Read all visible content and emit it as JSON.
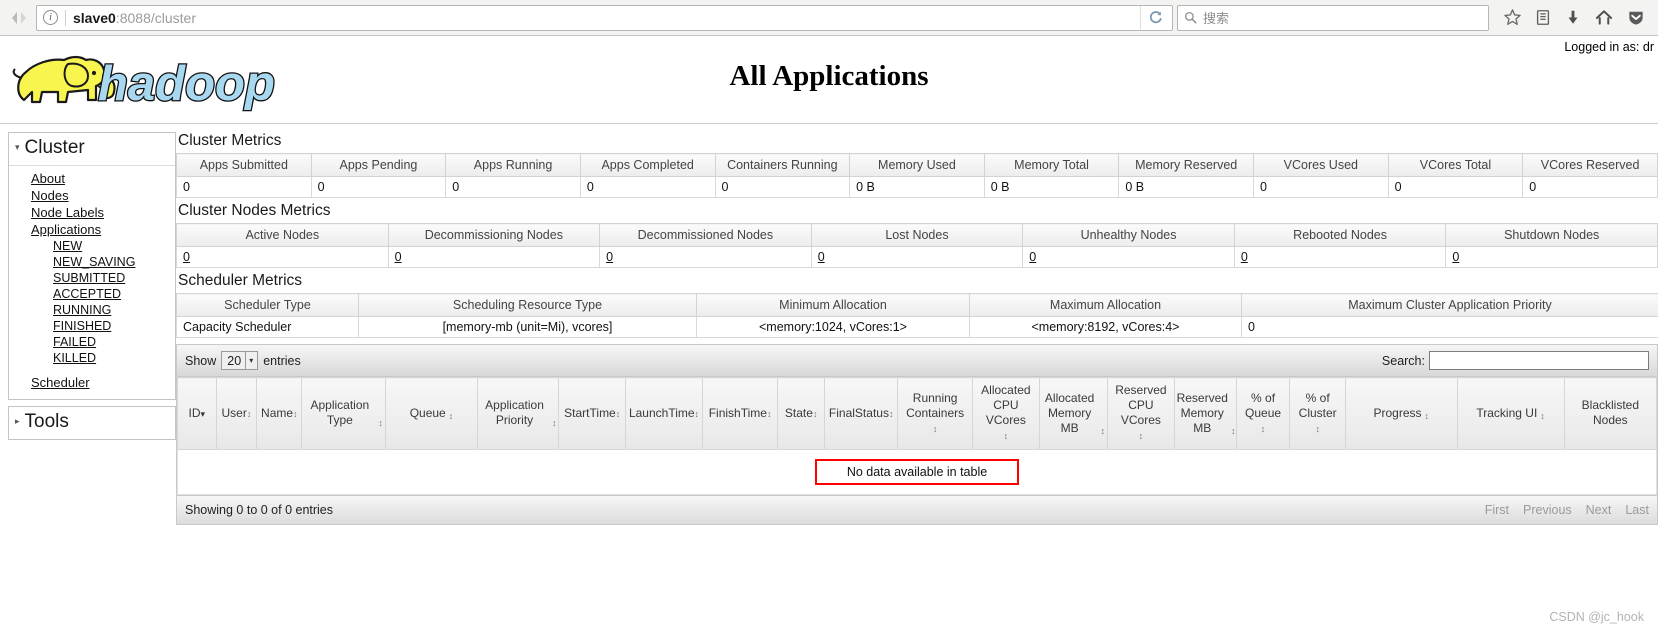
{
  "browser": {
    "url_host": "slave0",
    "url_rest": ":8088/cluster",
    "search_placeholder": "搜索",
    "icons": {
      "back": "back-arrow-icon",
      "forward": "forward-arrow-icon",
      "info": "info-icon",
      "reload": "reload-icon",
      "search": "search-icon",
      "bookmark": "star-icon",
      "library": "library-icon",
      "downloads": "download-arrow-icon",
      "home": "home-icon",
      "pocket": "shield-icon"
    }
  },
  "header": {
    "title": "All Applications",
    "logo_text": "hadoop",
    "logged_in": "Logged in as: dr"
  },
  "sidebar": {
    "cluster": {
      "title": "Cluster",
      "links": [
        {
          "label": "About",
          "sub": false
        },
        {
          "label": "Nodes",
          "sub": false
        },
        {
          "label": "Node Labels",
          "sub": false
        },
        {
          "label": "Applications",
          "sub": false
        },
        {
          "label": "NEW",
          "sub": true
        },
        {
          "label": "NEW_SAVING",
          "sub": true
        },
        {
          "label": "SUBMITTED",
          "sub": true
        },
        {
          "label": "ACCEPTED",
          "sub": true
        },
        {
          "label": "RUNNING",
          "sub": true
        },
        {
          "label": "FINISHED",
          "sub": true
        },
        {
          "label": "FAILED",
          "sub": true
        },
        {
          "label": "KILLED",
          "sub": true
        },
        {
          "label": "Scheduler",
          "sub": false
        }
      ]
    },
    "tools": {
      "title": "Tools"
    }
  },
  "cluster_metrics": {
    "title": "Cluster Metrics",
    "columns": [
      "Apps Submitted",
      "Apps Pending",
      "Apps Running",
      "Apps Completed",
      "Containers Running",
      "Memory Used",
      "Memory Total",
      "Memory Reserved",
      "VCores Used",
      "VCores Total",
      "VCores Reserved"
    ],
    "values": [
      "0",
      "0",
      "0",
      "0",
      "0",
      "0 B",
      "0 B",
      "0 B",
      "0",
      "0",
      "0"
    ]
  },
  "cluster_nodes_metrics": {
    "title": "Cluster Nodes Metrics",
    "columns": [
      "Active Nodes",
      "Decommissioning Nodes",
      "Decommissioned Nodes",
      "Lost Nodes",
      "Unhealthy Nodes",
      "Rebooted Nodes",
      "Shutdown Nodes"
    ],
    "values": [
      "0",
      "0",
      "0",
      "0",
      "0",
      "0",
      "0"
    ]
  },
  "scheduler_metrics": {
    "title": "Scheduler Metrics",
    "columns": [
      "Scheduler Type",
      "Scheduling Resource Type",
      "Minimum Allocation",
      "Maximum Allocation",
      "Maximum Cluster Application Priority"
    ],
    "values": [
      "Capacity Scheduler",
      "[memory-mb (unit=Mi), vcores]",
      "<memory:1024, vCores:1>",
      "<memory:8192, vCores:4>",
      "0"
    ]
  },
  "datatable": {
    "show_label": "Show",
    "entries_value": "20",
    "entries_label": "entries",
    "search_label": "Search:",
    "search_value": "",
    "columns": [
      {
        "label": "ID",
        "sort": "desc"
      },
      {
        "label": "User",
        "sort": "both"
      },
      {
        "label": "Name",
        "sort": "both"
      },
      {
        "label": "Application Type",
        "sort": "both"
      },
      {
        "label": "Queue",
        "sort": "both"
      },
      {
        "label": "Application Priority",
        "sort": "both"
      },
      {
        "label": "StartTime",
        "sort": "both"
      },
      {
        "label": "LaunchTime",
        "sort": "both"
      },
      {
        "label": "FinishTime",
        "sort": "both"
      },
      {
        "label": "State",
        "sort": "both"
      },
      {
        "label": "FinalStatus",
        "sort": "both"
      },
      {
        "label": "Running Containers",
        "sort": "both"
      },
      {
        "label": "Allocated CPU VCores",
        "sort": "both"
      },
      {
        "label": "Allocated Memory MB",
        "sort": "both"
      },
      {
        "label": "Reserved CPU VCores",
        "sort": "both"
      },
      {
        "label": "Reserved Memory MB",
        "sort": "both"
      },
      {
        "label": "% of Queue",
        "sort": "both"
      },
      {
        "label": "% of Cluster",
        "sort": "both"
      },
      {
        "label": "Progress",
        "sort": "both"
      },
      {
        "label": "Tracking UI",
        "sort": "both"
      },
      {
        "label": "Blacklisted Nodes",
        "sort": "none"
      }
    ],
    "empty_message": "No data available in table",
    "info_text": "Showing 0 to 0 of 0 entries",
    "pager": [
      "First",
      "Previous",
      "Next",
      "Last"
    ]
  },
  "watermark": "CSDN @jc_hook",
  "colors": {
    "accent_red": "#ff0000",
    "logo_blue": "#a8d8f0",
    "logo_yellow": "#f5f34a"
  }
}
